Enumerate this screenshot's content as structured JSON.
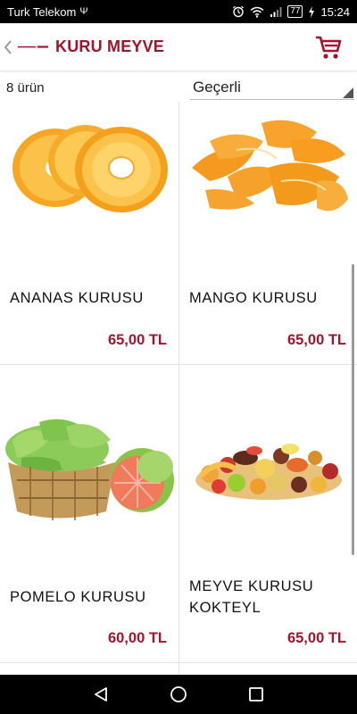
{
  "status_bar": {
    "carrier": "Turk Telekom",
    "usb_symbol": "Ψ",
    "battery": "77",
    "time": "15:24"
  },
  "header": {
    "title": "KURU MEYVE",
    "back_icon": "chevron-left-icon",
    "cart_icon": "cart-icon"
  },
  "toolbar": {
    "product_count": "8 ürün",
    "sort_selected": "Geçerli"
  },
  "products": [
    {
      "name": "ANANAS KURUSU",
      "price": "65,00 TL",
      "image": "dried-pineapple-image"
    },
    {
      "name": "MANGO KURUSU",
      "price": "65,00 TL",
      "image": "dried-mango-image"
    },
    {
      "name": "POMELO KURUSU",
      "price": "60,00 TL",
      "image": "dried-pomelo-image"
    },
    {
      "name": "MEYVE KURUSU KOKTEYL",
      "price": "65,00 TL",
      "image": "dried-fruit-mix-image"
    }
  ],
  "colors": {
    "brand": "#a3132c",
    "text": "#111111",
    "divider": "#e4e4e4"
  },
  "nav_bar": {
    "back": "triangle-back-icon",
    "home": "circle-home-icon",
    "recents": "square-recents-icon"
  }
}
